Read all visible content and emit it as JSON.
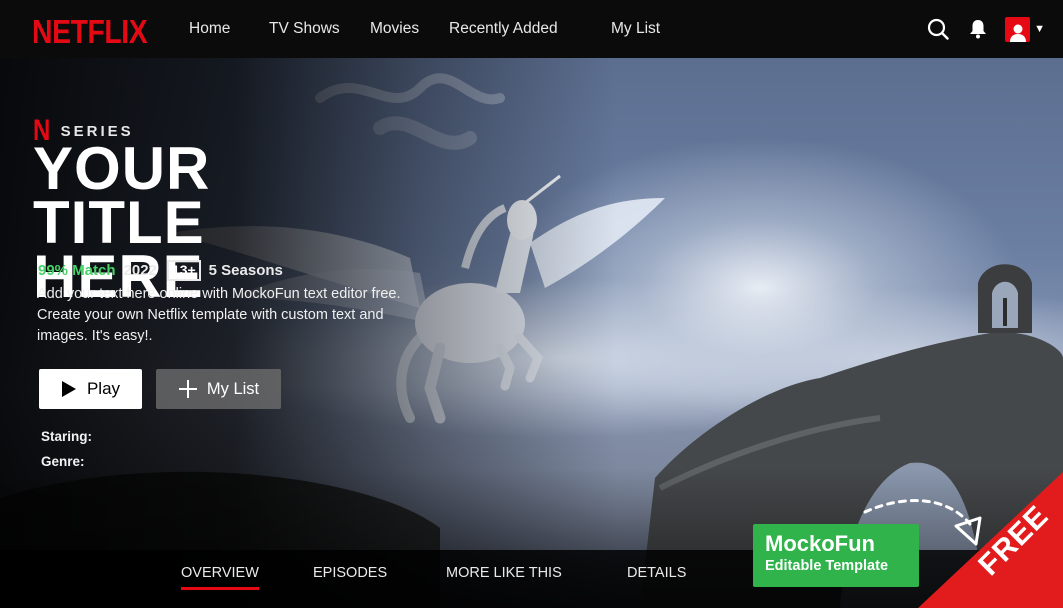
{
  "header": {
    "logo": "NETFLIX",
    "nav": [
      {
        "label": "Home"
      },
      {
        "label": "TV Shows"
      },
      {
        "label": "Movies"
      },
      {
        "label": "Recently Added"
      },
      {
        "label": "My List"
      }
    ],
    "icons": [
      "search-icon",
      "bell-icon",
      "avatar",
      "chevron-down-icon"
    ]
  },
  "hero": {
    "badge_mark": "N",
    "badge_label": "SERIES",
    "title": "YOUR TITLE HERE",
    "match": "99% Match",
    "year": "2022",
    "rating": "13+",
    "seasons": "5 Seasons",
    "description": "Add your text here online with MockoFun text editor free. Create your own Netflix template with custom text and images. It's easy!.",
    "play_label": "Play",
    "mylist_label": "My List",
    "starring_label": "Staring:",
    "genre_label": "Genre:"
  },
  "tabs": [
    {
      "label": "OVERVIEW",
      "active": true
    },
    {
      "label": "EPISODES",
      "active": false
    },
    {
      "label": "MORE LIKE THIS",
      "active": false
    },
    {
      "label": "DETAILS",
      "active": false
    }
  ],
  "promo": {
    "title": "MockoFun",
    "subtitle": "Editable Template",
    "corner": "FREE"
  },
  "colors": {
    "brand_red": "#e50914",
    "match_green": "#46d369",
    "promo_green": "#2fb34a"
  }
}
